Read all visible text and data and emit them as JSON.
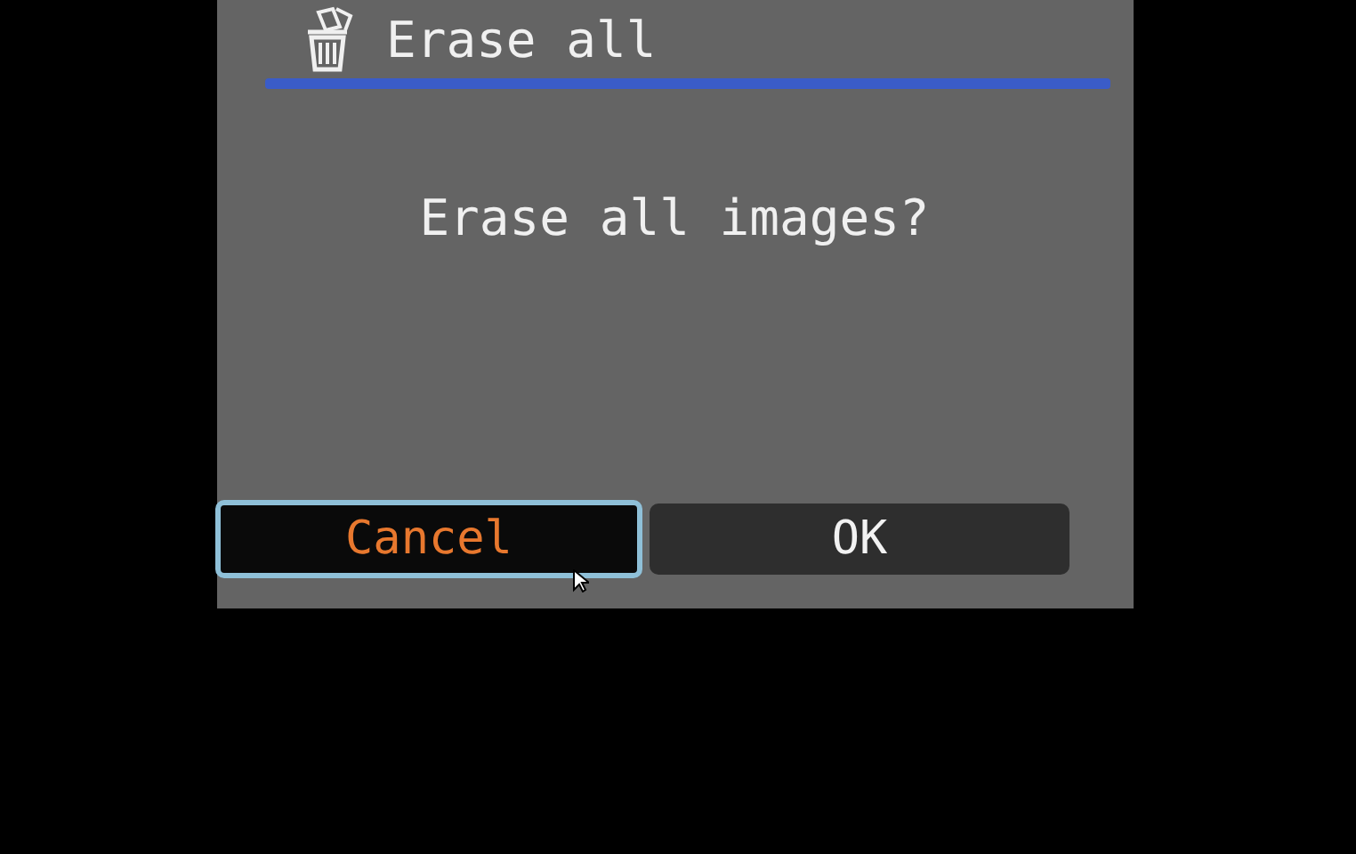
{
  "dialog": {
    "title": "Erase all",
    "message": "Erase all images?",
    "buttons": [
      {
        "label": "Cancel",
        "selected": true
      },
      {
        "label": "OK",
        "selected": false
      }
    ]
  }
}
